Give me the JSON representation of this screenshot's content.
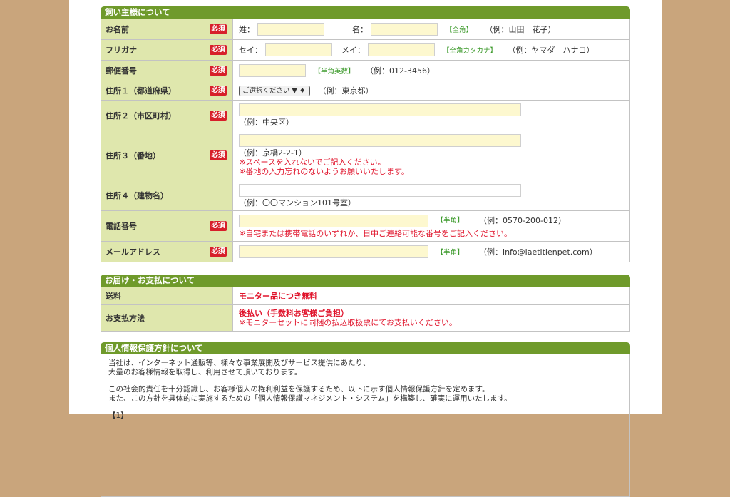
{
  "owner_section": {
    "title": "飼い主様について",
    "required_label": "必須",
    "name": {
      "label": "お名前",
      "last_prefix": "姓：",
      "first_prefix": "名：",
      "tag": "【全角】",
      "example": "（例：山田　花子）"
    },
    "furigana": {
      "label": "フリガナ",
      "last_prefix": "セイ：",
      "first_prefix": "メイ：",
      "tag": "【全角カタカナ】",
      "example": "（例：ヤマダ　ハナコ）"
    },
    "postal": {
      "label": "郵便番号",
      "tag": "【半角英数】",
      "example": "（例：012-3456）"
    },
    "address1": {
      "label": "住所１（都道府県）",
      "select_value": "ご選択ください ▼ ♦",
      "example": "（例：東京都）"
    },
    "address2": {
      "label": "住所２（市区町村）",
      "example": "（例：中央区）"
    },
    "address3": {
      "label": "住所３（番地）",
      "example": "（例：京橋2-2-1）",
      "note1": "※スペースを入れないでご記入ください。",
      "note2": "※番地の入力忘れのないようお願いいたします。"
    },
    "address4": {
      "label": "住所４（建物名）",
      "example": "（例：〇〇マンション101号室）"
    },
    "phone": {
      "label": "電話番号",
      "tag": "【半角】",
      "example": "（例：0570-200-012）",
      "note": "※自宅または携帯電話のいずれか、日中ご連絡可能な番号をご記入ください。"
    },
    "email": {
      "label": "メールアドレス",
      "tag": "【半角】",
      "example": "（例：info@laetitienpet.com）"
    }
  },
  "delivery_section": {
    "title": "お届け・お支払について",
    "shipping": {
      "label": "送料",
      "value": "モニター品につき無料"
    },
    "payment": {
      "label": "お支払方法",
      "value": "後払い（手数料お客様ご負担）",
      "note": "※モニターセットに同梱の払込取扱票にてお支払いください。"
    }
  },
  "privacy_section": {
    "title": "個人情報保護方針について",
    "para1_line1": "当社は、インターネット通販等、様々な事業展開及びサービス提供にあたり、",
    "para1_line2": "大量のお客様情報を取得し、利用させて頂いております。",
    "para2_line1": "この社会的責任を十分認識し、お客様個人の権利利益を保護するため、以下に示す個人情報保護方針を定めます。",
    "para2_line2": "また、この方針を具体的に実施するための「個人情報保護マネジメント・システム」を構築し、確実に運用いたします。",
    "para3": "【1】"
  }
}
